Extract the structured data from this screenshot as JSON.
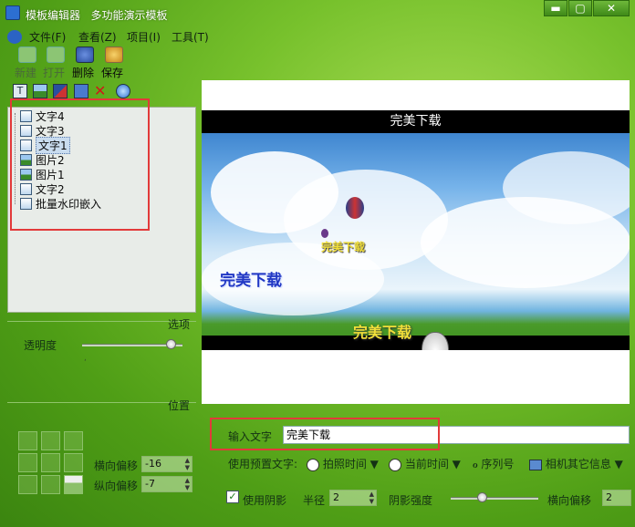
{
  "window": {
    "title": "模板编辑器",
    "subtitle": "多功能演示模板",
    "btn_minimize": "▬",
    "btn_maximize": "▢",
    "btn_close": "✕"
  },
  "menu": {
    "file": "文件(F)",
    "view": "查看(Z)",
    "item": "项目(I)",
    "tools": "工具(T)"
  },
  "toolbar": {
    "new": "新建",
    "open": "打开",
    "delete": "删除",
    "save": "保存"
  },
  "tree": {
    "items": [
      "文字4",
      "文字3",
      "文字1",
      "图片2",
      "图片1",
      "文字2",
      "批量水印嵌入"
    ],
    "selected": "文字1"
  },
  "options": {
    "section_label": "选项",
    "opacity_label": "透明度",
    "opacity_value": 0.88,
    "position_label": "位置",
    "h_offset_label": "横向偏移",
    "h_offset_value": "-16",
    "v_offset_label": "纵向偏移",
    "v_offset_value": "-7"
  },
  "preview": {
    "top_bar_text": "完美下载",
    "wm_yellow_small": "完美下载",
    "wm_blue": "完美下载",
    "wm_yellow_large": "完美下载",
    "bottom_bar_text": "完美下载"
  },
  "text_input": {
    "label": "输入文字",
    "value": "完美下载"
  },
  "preset": {
    "label": "使用预置文字:",
    "shot_time": "拍照时间",
    "current_time": "当前时间",
    "serial": "序列号",
    "camera_info": "相机其它信息"
  },
  "shadow": {
    "use_shadow_label": "使用阴影",
    "use_shadow_checked": true,
    "radius_label": "半径",
    "radius_value": "2",
    "strength_label": "阴影强度",
    "strength_value": 0.35,
    "h_offset_label": "横向偏移",
    "h_offset_value": "2"
  },
  "colors": {
    "theme_green": "#5aa81c",
    "highlight_red": "#e23a3a"
  }
}
